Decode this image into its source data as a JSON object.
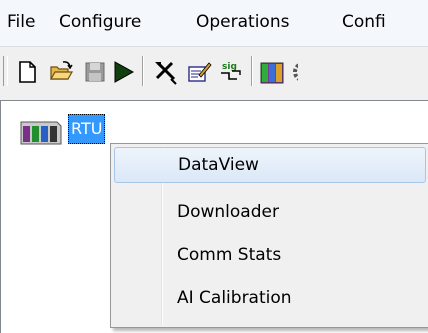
{
  "menubar": {
    "items": [
      "File",
      "Configure",
      "Operations",
      "Confi"
    ]
  },
  "toolbar": {
    "buttons": [
      "new-icon",
      "open-icon",
      "save-icon",
      "run-icon",
      "tools-icon",
      "edit-icon",
      "signal-icon",
      "rtu-module-icon"
    ]
  },
  "tree": {
    "node": {
      "label": "RTU",
      "icon": "rtu-icon"
    }
  },
  "context_menu": {
    "items": [
      {
        "label": "DataView",
        "highlighted": true
      },
      {
        "label": "Downloader"
      },
      {
        "label": "Comm Stats"
      },
      {
        "label": "AI Calibration"
      }
    ]
  },
  "colors": {
    "selection": "#3399ff",
    "menu_background": "#f0f0f0",
    "highlight_border": "#a8c5e8"
  }
}
